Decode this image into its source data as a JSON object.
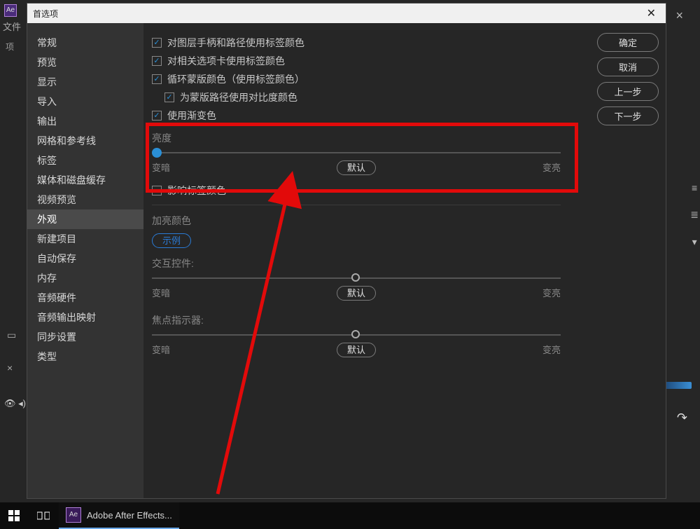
{
  "bg": {
    "menu_file": "文件",
    "project_label": "项"
  },
  "taskbar": {
    "app_label": "Adobe After Effects..."
  },
  "dialog": {
    "title": "首选项"
  },
  "sidebar": {
    "items": [
      {
        "label": "常规"
      },
      {
        "label": "预览"
      },
      {
        "label": "显示"
      },
      {
        "label": "导入"
      },
      {
        "label": "输出"
      },
      {
        "label": "网格和参考线"
      },
      {
        "label": "标签"
      },
      {
        "label": "媒体和磁盘缓存"
      },
      {
        "label": "视频预览"
      },
      {
        "label": "外观",
        "selected": true
      },
      {
        "label": "新建项目"
      },
      {
        "label": "自动保存"
      },
      {
        "label": "内存"
      },
      {
        "label": "音频硬件"
      },
      {
        "label": "音频输出映射"
      },
      {
        "label": "同步设置"
      },
      {
        "label": "类型"
      }
    ]
  },
  "buttons": {
    "ok": "确定",
    "cancel": "取消",
    "prev": "上一步",
    "next": "下一步"
  },
  "checkboxes": {
    "layer_handles": "对图层手柄和路径使用标签颜色",
    "related_tabs": "对相关选项卡使用标签颜色",
    "cycle_mask": "循环蒙版颜色（使用标签颜色）",
    "mask_contrast": "为蒙版路径使用对比度颜色",
    "use_gradient": "使用渐变色",
    "affect_label": "影响标签颜色"
  },
  "brightness": {
    "title": "亮度",
    "darker": "变暗",
    "default_btn": "默认",
    "brighter": "变亮"
  },
  "highlight": {
    "title": "加亮颜色",
    "sample": "示例",
    "interactive": "交互控件:",
    "focus": "焦点指示器:",
    "darker": "变暗",
    "default_btn": "默认",
    "brighter": "变亮"
  }
}
